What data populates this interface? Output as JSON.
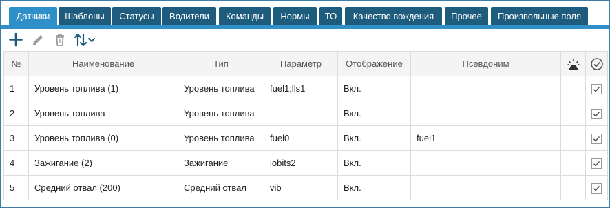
{
  "tabs": [
    {
      "label": "Датчики",
      "active": true
    },
    {
      "label": "Шаблоны"
    },
    {
      "label": "Статусы"
    },
    {
      "label": "Водители"
    },
    {
      "label": "Команды"
    },
    {
      "label": "Нормы"
    },
    {
      "label": "ТО"
    },
    {
      "label": "Качество вождения"
    },
    {
      "label": "Прочее"
    },
    {
      "label": "Произвольные поля"
    }
  ],
  "toolbar": {
    "add_icon": "plus-icon",
    "edit_icon": "pencil-icon",
    "delete_icon": "trash-icon",
    "sort_icon": "sort-arrows-icon"
  },
  "table": {
    "columns": [
      "№",
      "Наименование",
      "Тип",
      "Параметр",
      "Отображение",
      "Псевдоним"
    ],
    "alarm_icon": "alarm-light-icon",
    "check_icon": "check-circle-icon",
    "rows": [
      {
        "num": "1",
        "name": "Уровень топлива (1)",
        "type": "Уровень топлива",
        "param": "fuel1;lls1",
        "display": "Вкл.",
        "alias": "",
        "checked": true
      },
      {
        "num": "2",
        "name": "Уровень топлива",
        "type": "Уровень топлива",
        "param": "",
        "display": "Вкл.",
        "alias": "",
        "checked": true
      },
      {
        "num": "3",
        "name": "Уровень топлива (0)",
        "type": "Уровень топлива",
        "param": "fuel0",
        "display": "Вкл.",
        "alias": "fuel1",
        "checked": true
      },
      {
        "num": "4",
        "name": "Зажигание (2)",
        "type": "Зажигание",
        "param": "iobits2",
        "display": "Вкл.",
        "alias": "",
        "checked": true
      },
      {
        "num": "5",
        "name": "Средний отвал (200)",
        "type": "Средний отвал",
        "param": "vib",
        "display": "Вкл.",
        "alias": "",
        "checked": true
      }
    ]
  },
  "colors": {
    "tab": "#1d5c7d",
    "tab_active": "#2f8fc8",
    "icon": "#1d5c7d",
    "icon_disabled": "#9a9a9a"
  }
}
